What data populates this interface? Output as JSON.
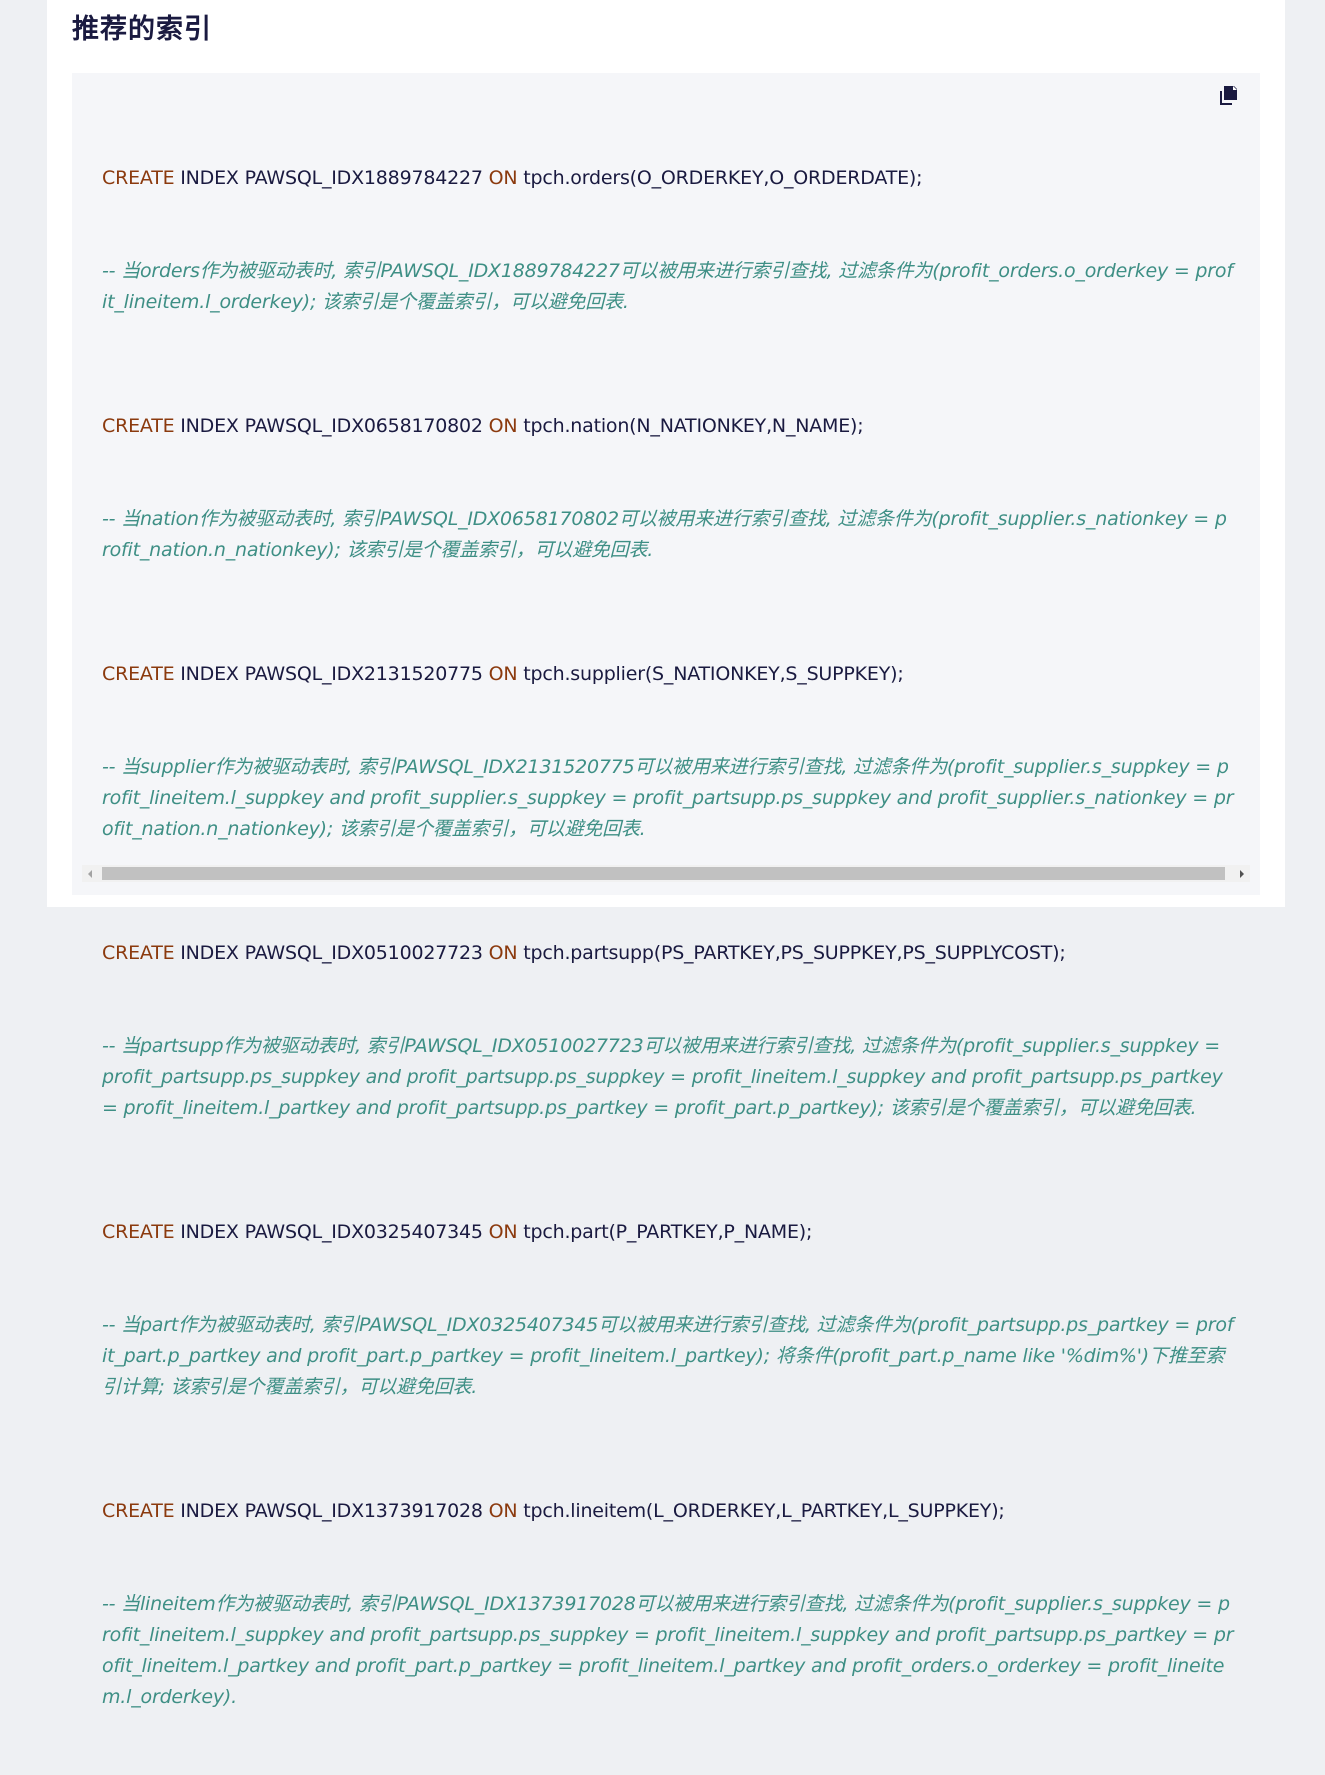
{
  "section": {
    "title": "推荐的索引"
  },
  "copy_icon": "copy-icon",
  "colors": {
    "keyword": "#8b3a0e",
    "comment": "#3e8f85",
    "text": "#1a1a40",
    "background": "#f5f6f9"
  },
  "code_lines": [
    {
      "kind": "stmt",
      "kw1": "CREATE",
      "mid1": " INDEX PAWSQL_IDX1889784227 ",
      "kw2": "ON",
      "rest": " tpch.orders(O_ORDERKEY,O_ORDERDATE);"
    },
    {
      "kind": "comment",
      "text": "-- 当orders作为被驱动表时, 索引PAWSQL_IDX1889784227可以被用来进行索引查找, 过滤条件为(profit_orders.o_orderkey = profit_lineitem.l_orderkey); 该索引是个覆盖索引，可以避免回表."
    },
    {
      "kind": "stmt",
      "kw1": "CREATE",
      "mid1": " INDEX PAWSQL_IDX0658170802 ",
      "kw2": "ON",
      "rest": " tpch.nation(N_NATIONKEY,N_NAME);"
    },
    {
      "kind": "comment",
      "text": "-- 当nation作为被驱动表时, 索引PAWSQL_IDX0658170802可以被用来进行索引查找, 过滤条件为(profit_supplier.s_nationkey = profit_nation.n_nationkey); 该索引是个覆盖索引，可以避免回表."
    },
    {
      "kind": "stmt",
      "kw1": "CREATE",
      "mid1": " INDEX PAWSQL_IDX2131520775 ",
      "kw2": "ON",
      "rest": " tpch.supplier(S_NATIONKEY,S_SUPPKEY);"
    },
    {
      "kind": "comment",
      "text": "-- 当supplier作为被驱动表时, 索引PAWSQL_IDX2131520775可以被用来进行索引查找, 过滤条件为(profit_supplier.s_suppkey = profit_lineitem.l_suppkey and profit_supplier.s_suppkey = profit_partsupp.ps_suppkey and profit_supplier.s_nationkey = profit_nation.n_nationkey); 该索引是个覆盖索引，可以避免回表."
    },
    {
      "kind": "stmt",
      "kw1": "CREATE",
      "mid1": " INDEX PAWSQL_IDX0510027723 ",
      "kw2": "ON",
      "rest": " tpch.partsupp(PS_PARTKEY,PS_SUPPKEY,PS_SUPPLYCOST);"
    },
    {
      "kind": "comment",
      "text": "-- 当partsupp作为被驱动表时, 索引PAWSQL_IDX0510027723可以被用来进行索引查找, 过滤条件为(profit_supplier.s_suppkey = profit_partsupp.ps_suppkey and profit_partsupp.ps_suppkey = profit_lineitem.l_suppkey and profit_partsupp.ps_partkey = profit_lineitem.l_partkey and profit_partsupp.ps_partkey = profit_part.p_partkey); 该索引是个覆盖索引，可以避免回表."
    },
    {
      "kind": "stmt",
      "kw1": "CREATE",
      "mid1": " INDEX PAWSQL_IDX0325407345 ",
      "kw2": "ON",
      "rest": " tpch.part(P_PARTKEY,P_NAME);"
    },
    {
      "kind": "comment",
      "text": "-- 当part作为被驱动表时, 索引PAWSQL_IDX0325407345可以被用来进行索引查找, 过滤条件为(profit_partsupp.ps_partkey = profit_part.p_partkey and profit_part.p_partkey = profit_lineitem.l_partkey); 将条件(profit_part.p_name like '%dim%')下推至索引计算; 该索引是个覆盖索引，可以避免回表."
    },
    {
      "kind": "stmt",
      "kw1": "CREATE",
      "mid1": " INDEX PAWSQL_IDX1373917028 ",
      "kw2": "ON",
      "rest": " tpch.lineitem(L_ORDERKEY,L_PARTKEY,L_SUPPKEY);"
    },
    {
      "kind": "comment",
      "text": "-- 当lineitem作为被驱动表时, 索引PAWSQL_IDX1373917028可以被用来进行索引查找, 过滤条件为(profit_supplier.s_suppkey = profit_lineitem.l_suppkey and profit_partsupp.ps_suppkey = profit_lineitem.l_suppkey and profit_partsupp.ps_partkey = profit_lineitem.l_partkey and profit_part.p_partkey = profit_lineitem.l_partkey and profit_orders.o_orderkey = profit_lineitem.l_orderkey)."
    }
  ]
}
